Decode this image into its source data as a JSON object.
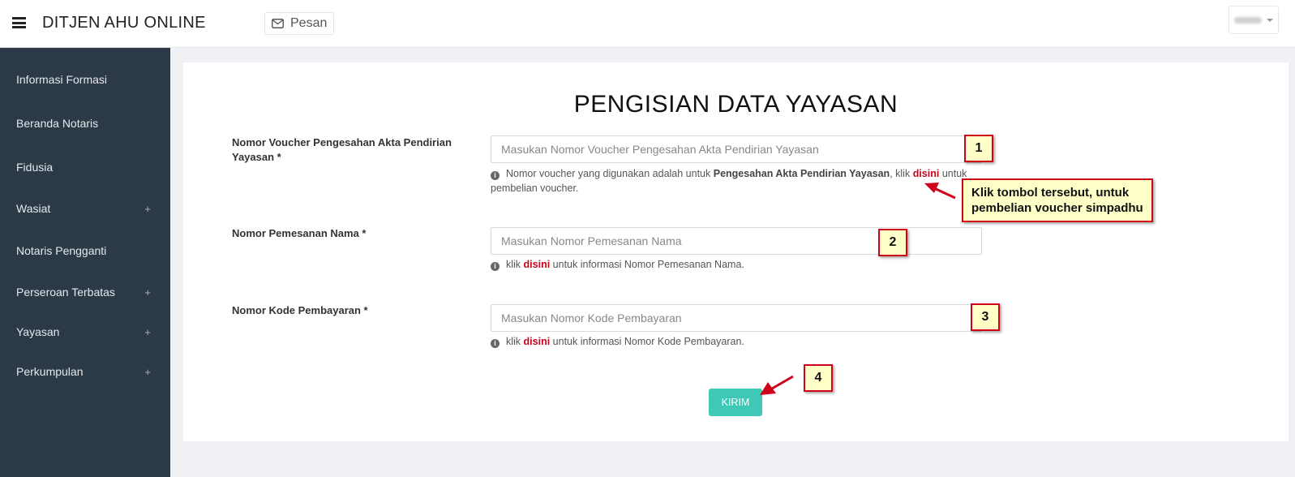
{
  "header": {
    "app_title": "DITJEN AHU ONLINE",
    "messages_label": "Pesan",
    "messages_icon": "envelope-icon"
  },
  "sidebar": {
    "items": [
      {
        "label": "Informasi Formasi",
        "expandable": false
      },
      {
        "label": "Beranda Notaris",
        "expandable": false
      },
      {
        "label": "Fidusia",
        "expandable": false
      },
      {
        "label": "Wasiat",
        "expandable": true
      },
      {
        "label": "Notaris Pengganti",
        "expandable": false
      },
      {
        "label": "Perseroan Terbatas",
        "expandable": true
      },
      {
        "label": "Yayasan",
        "expandable": true
      },
      {
        "label": "Perkumpulan",
        "expandable": true
      }
    ],
    "expand_symbol": "+"
  },
  "form": {
    "title": "PENGISIAN DATA YAYASAN",
    "voucher": {
      "label": "Nomor Voucher Pengesahan Akta Pendirian Yayasan *",
      "placeholder": "Masukan Nomor Voucher Pengesahan Akta Pendirian Yayasan",
      "help_prefix": "Nomor voucher yang digunakan adalah untuk ",
      "help_bold": "Pengesahan Akta Pendirian Yayasan",
      "help_mid": ", klik ",
      "help_link": "disini",
      "help_suffix": " untuk pembelian voucher."
    },
    "pemesanan": {
      "label": "Nomor Pemesanan Nama *",
      "placeholder": "Masukan Nomor Pemesanan Nama",
      "help_prefix": "klik ",
      "help_link": "disini",
      "help_suffix": " untuk informasi Nomor Pemesanan Nama."
    },
    "kode": {
      "label": "Nomor Kode Pembayaran *",
      "placeholder": "Masukan Nomor Kode Pembayaran",
      "help_prefix": "klik ",
      "help_link": "disini",
      "help_suffix": " untuk informasi Nomor Kode Pembayaran."
    },
    "submit_label": "KIRIM"
  },
  "annotations": {
    "step1": "1",
    "step2": "2",
    "step3": "3",
    "step4": "4",
    "note_line1": "Klik tombol tersebut, untuk",
    "note_line2": "pembelian voucher simpadhu",
    "accent": "#d0021b",
    "fill": "#ffffc8"
  },
  "colors": {
    "sidebar_bg": "#2c3a47",
    "submit_bg": "#3fc8b6",
    "link": "#d0021b"
  }
}
